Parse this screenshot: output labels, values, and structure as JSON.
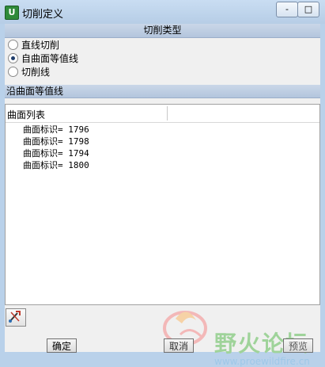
{
  "window": {
    "title": "切削定义",
    "minimize": "-",
    "maximize": "□"
  },
  "app_icon_glyph": "U",
  "cut_type": {
    "header": "切削类型",
    "options": [
      {
        "label": "直线切削",
        "selected": false
      },
      {
        "label": "自曲面等值线",
        "selected": true
      },
      {
        "label": "切削线",
        "selected": false
      }
    ]
  },
  "surface_iso": {
    "header": "沿曲面等值线",
    "list_header": "曲面列表",
    "items": [
      "曲面标识= 1796",
      "曲面标识= 1798",
      "曲面标识= 1794",
      "曲面标识= 1800"
    ]
  },
  "tools": {
    "icon": "pick-tool-icon"
  },
  "buttons": {
    "ok": "确定",
    "cancel": "取消",
    "preview": "预览"
  },
  "watermark": {
    "text": "野火论坛",
    "url": "www.proewildfire.cn"
  },
  "colors": {
    "titlebar": "#b9d1ea",
    "section_header": "#b3c5dd",
    "client": "#f0f0f0"
  }
}
